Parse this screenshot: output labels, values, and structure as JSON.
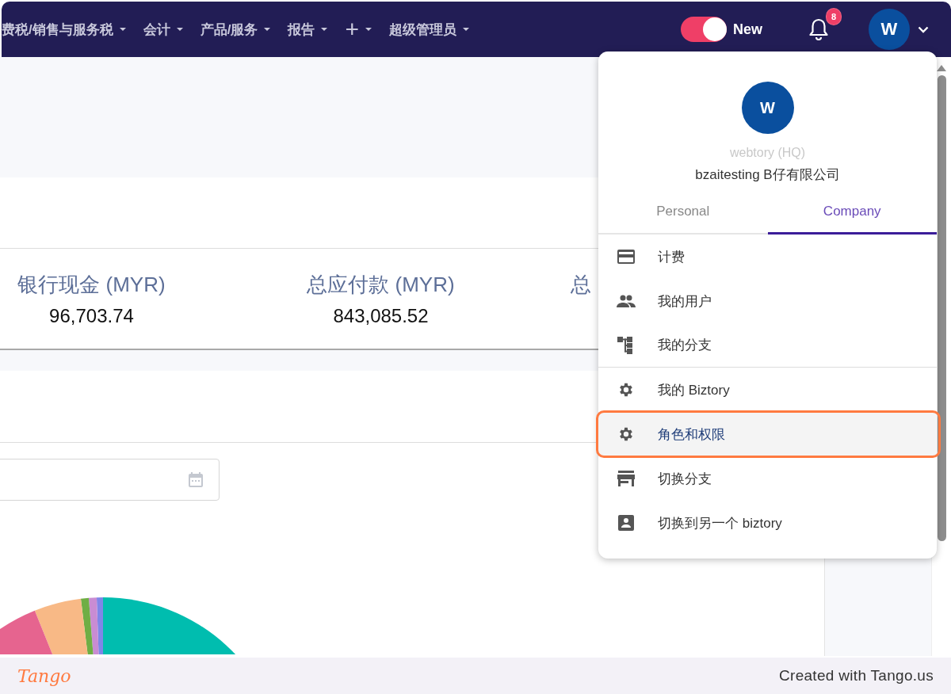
{
  "nav": {
    "items": [
      {
        "label": "费税/销售与服务税",
        "kind": "text"
      },
      {
        "label": "会计",
        "kind": "text"
      },
      {
        "label": "产品/服务",
        "kind": "text"
      },
      {
        "label": "报告",
        "kind": "text"
      },
      {
        "label": "+",
        "kind": "glyph"
      },
      {
        "label": "超级管理员",
        "kind": "text"
      }
    ],
    "toggle": {
      "label": "New",
      "on": true
    },
    "notifications": {
      "count": "8"
    },
    "avatar": {
      "initial": "W"
    }
  },
  "stats": [
    {
      "label": "银行现金 (MYR)",
      "value": "96,703.74"
    },
    {
      "label": "总应付款 (MYR)",
      "value": "843,085.52"
    },
    {
      "label": "总"
    }
  ],
  "date_field": {
    "kind": "date"
  },
  "user_menu": {
    "avatar": "W",
    "branch": "webtory (HQ)",
    "company": "bzaitesting B仔有限公司",
    "tabs": [
      {
        "label": "Personal",
        "selected": false
      },
      {
        "label": "Company",
        "selected": true
      }
    ],
    "items": [
      {
        "label": "计费",
        "kind": "card",
        "highlighted": false
      },
      {
        "label": "我的用户",
        "kind": "people",
        "highlighted": false
      },
      {
        "label": "我的分支",
        "kind": "tree",
        "highlighted": false,
        "divider_after": true
      },
      {
        "label": "我的 Biztory",
        "kind": "gear",
        "highlighted": false
      },
      {
        "label": "角色和权限",
        "kind": "gear",
        "highlighted": true
      },
      {
        "label": "切换分支",
        "kind": "store",
        "highlighted": false
      },
      {
        "label": "切换到另一个 biztory",
        "kind": "contact",
        "highlighted": false
      }
    ]
  },
  "footer": {
    "logo": "Tango",
    "credit": "Created with Tango.us"
  }
}
